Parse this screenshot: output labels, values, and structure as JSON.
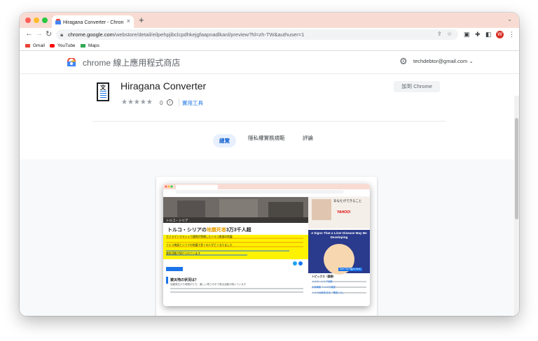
{
  "browser": {
    "tab_title": "Hiragana Converter - Chrome 線",
    "url_host": "chrome.google.com",
    "url_path": "/webstore/detail/eilpehpjibclcpdhkejgfaapnadlkanl/preview?hl=zh-TW&authuser=1",
    "profile_initial": "W"
  },
  "bookmarks": [
    {
      "label": "Gmail",
      "color": "#ea4335"
    },
    {
      "label": "YouTube",
      "color": "#ff0000"
    },
    {
      "label": "Maps",
      "color": "#34a853"
    }
  ],
  "store": {
    "name": "chrome 線上應用程式商店",
    "account": "techdebtor@gmail.com"
  },
  "extension": {
    "icon_char": "文",
    "name": "Hiragana Converter",
    "rating_stars": "★★★★★",
    "rating_count": "0",
    "rating_value": 0,
    "category": "實用工具",
    "add_button": "加到 Chrome"
  },
  "tabs": [
    {
      "label": "總覽",
      "active": true
    },
    {
      "label": "隱私權實務規範",
      "active": false
    },
    {
      "label": "評論",
      "active": false
    }
  ],
  "preview": {
    "headline_prefix": "トルコ・シリアの",
    "headline_highlight": "地震死者",
    "headline_suffix": "3万3千人超",
    "image_caption": "トルコ・シリア",
    "body_line1": "カフラマンマラシュで建物が倒壊したトルコ南部の地震",
    "body_line2": "トルコ南部とシリアの地震で多くの人が亡くなりました",
    "body_line3": "救助活動が続けられています",
    "qa_title": "被災地の状況は？",
    "qa_body": "地震発生から時間がたち、厳しい寒さの中で救出活動が続いています",
    "ad_text": "あなたができること",
    "ad_brand": "YAHOO!",
    "liver_title": "4 Signs That a Liver Disease May Be Developing",
    "liver_cta": "See The Signs Here",
    "topics_title": "トピックス（国際）",
    "topics": [
      "トルコ・シリア地震",
      "大量解雇 トルコで報道",
      "トルコ大統領 安全「確認した」"
    ]
  }
}
